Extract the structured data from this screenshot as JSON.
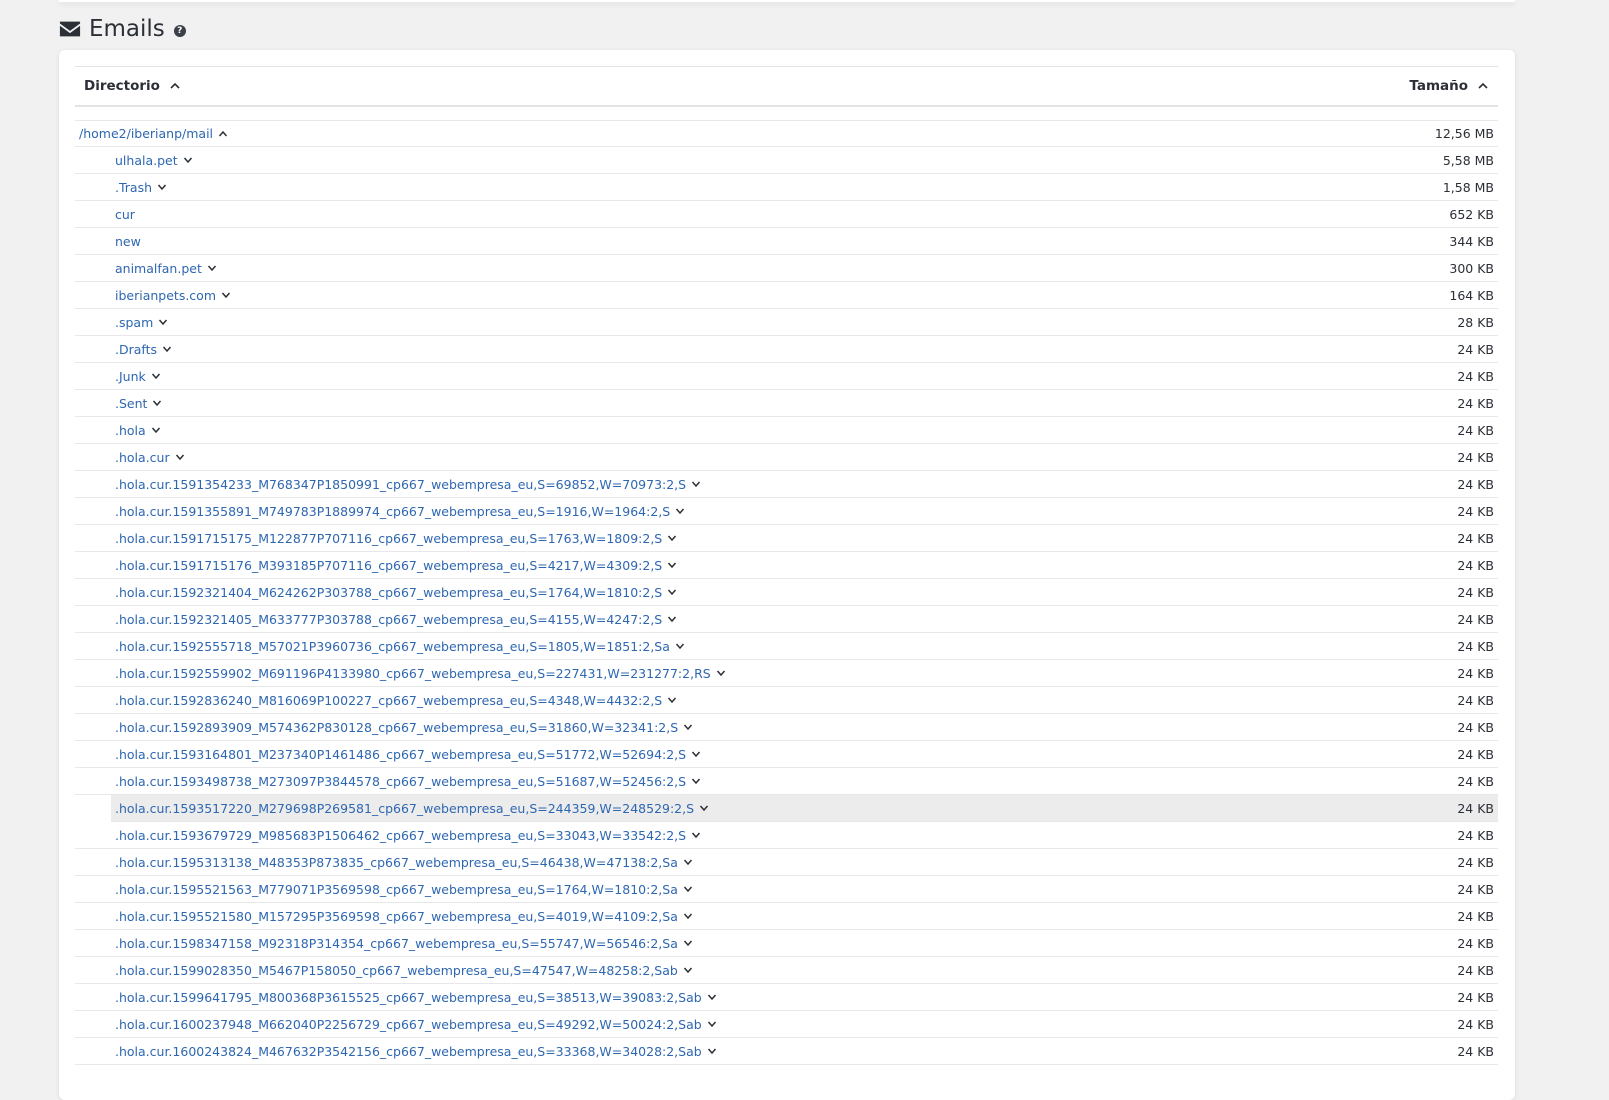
{
  "section": {
    "title": "Emails",
    "help_icon": "question-circle-icon",
    "title_icon": "envelope-icon"
  },
  "table": {
    "headers": {
      "directory": "Directorio",
      "size": "Tamaño"
    },
    "rows": [
      {
        "name": "/home2/iberianp/mail",
        "size": "12,56 MB",
        "level": 0,
        "chevron": "up"
      },
      {
        "name": "ulhala.pet",
        "size": "5,58 MB",
        "level": 1,
        "chevron": "down"
      },
      {
        "name": ".Trash",
        "size": "1,58 MB",
        "level": 1,
        "chevron": "down"
      },
      {
        "name": "cur",
        "size": "652 KB",
        "level": 1,
        "chevron": "none"
      },
      {
        "name": "new",
        "size": "344 KB",
        "level": 1,
        "chevron": "none"
      },
      {
        "name": "animalfan.pet",
        "size": "300 KB",
        "level": 1,
        "chevron": "down"
      },
      {
        "name": "iberianpets.com",
        "size": "164 KB",
        "level": 1,
        "chevron": "down"
      },
      {
        "name": ".spam",
        "size": "28 KB",
        "level": 1,
        "chevron": "down"
      },
      {
        "name": ".Drafts",
        "size": "24 KB",
        "level": 1,
        "chevron": "down"
      },
      {
        "name": ".Junk",
        "size": "24 KB",
        "level": 1,
        "chevron": "down"
      },
      {
        "name": ".Sent",
        "size": "24 KB",
        "level": 1,
        "chevron": "down"
      },
      {
        "name": ".hola",
        "size": "24 KB",
        "level": 1,
        "chevron": "down"
      },
      {
        "name": ".hola.cur",
        "size": "24 KB",
        "level": 1,
        "chevron": "down"
      },
      {
        "name": ".hola.cur.1591354233_M768347P1850991_cp667_webempresa_eu,S=69852,W=70973:2,S",
        "size": "24 KB",
        "level": 1,
        "chevron": "down"
      },
      {
        "name": ".hola.cur.1591355891_M749783P1889974_cp667_webempresa_eu,S=1916,W=1964:2,S",
        "size": "24 KB",
        "level": 1,
        "chevron": "down"
      },
      {
        "name": ".hola.cur.1591715175_M122877P707116_cp667_webempresa_eu,S=1763,W=1809:2,S",
        "size": "24 KB",
        "level": 1,
        "chevron": "down"
      },
      {
        "name": ".hola.cur.1591715176_M393185P707116_cp667_webempresa_eu,S=4217,W=4309:2,S",
        "size": "24 KB",
        "level": 1,
        "chevron": "down"
      },
      {
        "name": ".hola.cur.1592321404_M624262P303788_cp667_webempresa_eu,S=1764,W=1810:2,S",
        "size": "24 KB",
        "level": 1,
        "chevron": "down"
      },
      {
        "name": ".hola.cur.1592321405_M633777P303788_cp667_webempresa_eu,S=4155,W=4247:2,S",
        "size": "24 KB",
        "level": 1,
        "chevron": "down"
      },
      {
        "name": ".hola.cur.1592555718_M57021P3960736_cp667_webempresa_eu,S=1805,W=1851:2,Sa",
        "size": "24 KB",
        "level": 1,
        "chevron": "down"
      },
      {
        "name": ".hola.cur.1592559902_M691196P4133980_cp667_webempresa_eu,S=227431,W=231277:2,RS",
        "size": "24 KB",
        "level": 1,
        "chevron": "down"
      },
      {
        "name": ".hola.cur.1592836240_M816069P100227_cp667_webempresa_eu,S=4348,W=4432:2,S",
        "size": "24 KB",
        "level": 1,
        "chevron": "down"
      },
      {
        "name": ".hola.cur.1592893909_M574362P830128_cp667_webempresa_eu,S=31860,W=32341:2,S",
        "size": "24 KB",
        "level": 1,
        "chevron": "down"
      },
      {
        "name": ".hola.cur.1593164801_M237340P1461486_cp667_webempresa_eu,S=51772,W=52694:2,S",
        "size": "24 KB",
        "level": 1,
        "chevron": "down"
      },
      {
        "name": ".hola.cur.1593498738_M273097P3844578_cp667_webempresa_eu,S=51687,W=52456:2,S",
        "size": "24 KB",
        "level": 1,
        "chevron": "down"
      },
      {
        "name": ".hola.cur.1593517220_M279698P269581_cp667_webempresa_eu,S=244359,W=248529:2,S",
        "size": "24 KB",
        "level": 1,
        "chevron": "down",
        "highlight": true
      },
      {
        "name": ".hola.cur.1593679729_M985683P1506462_cp667_webempresa_eu,S=33043,W=33542:2,S",
        "size": "24 KB",
        "level": 1,
        "chevron": "down"
      },
      {
        "name": ".hola.cur.1595313138_M48353P873835_cp667_webempresa_eu,S=46438,W=47138:2,Sa",
        "size": "24 KB",
        "level": 1,
        "chevron": "down"
      },
      {
        "name": ".hola.cur.1595521563_M779071P3569598_cp667_webempresa_eu,S=1764,W=1810:2,Sa",
        "size": "24 KB",
        "level": 1,
        "chevron": "down"
      },
      {
        "name": ".hola.cur.1595521580_M157295P3569598_cp667_webempresa_eu,S=4019,W=4109:2,Sa",
        "size": "24 KB",
        "level": 1,
        "chevron": "down"
      },
      {
        "name": ".hola.cur.1598347158_M92318P314354_cp667_webempresa_eu,S=55747,W=56546:2,Sa",
        "size": "24 KB",
        "level": 1,
        "chevron": "down"
      },
      {
        "name": ".hola.cur.1599028350_M5467P158050_cp667_webempresa_eu,S=47547,W=48258:2,Sab",
        "size": "24 KB",
        "level": 1,
        "chevron": "down"
      },
      {
        "name": ".hola.cur.1599641795_M800368P3615525_cp667_webempresa_eu,S=38513,W=39083:2,Sab",
        "size": "24 KB",
        "level": 1,
        "chevron": "down"
      },
      {
        "name": ".hola.cur.1600237948_M662040P2256729_cp667_webempresa_eu,S=49292,W=50024:2,Sab",
        "size": "24 KB",
        "level": 1,
        "chevron": "down"
      },
      {
        "name": ".hola.cur.1600243824_M467632P3542156_cp667_webempresa_eu,S=33368,W=34028:2,Sab",
        "size": "24 KB",
        "level": 1,
        "chevron": "down"
      }
    ]
  },
  "colors": {
    "link": "#2e67b1",
    "text": "#2b2f36",
    "page_bg": "#f1f1f2",
    "card_bg": "#ffffff",
    "row_highlight": "#ececed"
  }
}
